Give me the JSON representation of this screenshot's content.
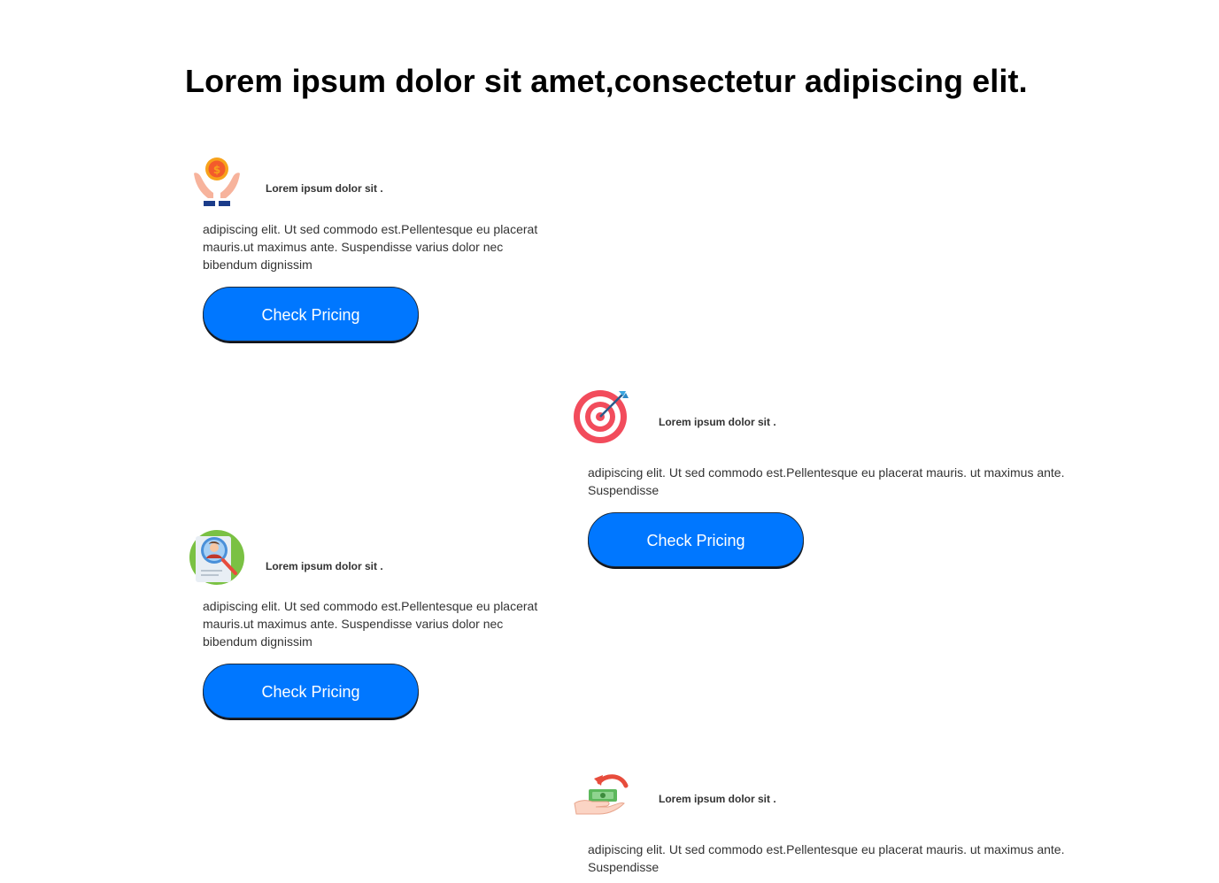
{
  "page": {
    "title": "Lorem ipsum dolor sit amet,consectetur adipiscing elit."
  },
  "features": [
    {
      "icon": "money-hands-icon",
      "heading": "Lorem ipsum dolor sit .",
      "description": "adipiscing elit. Ut sed commodo est.Pellentesque eu placerat mauris.ut maximus ante. Suspendisse varius dolor nec bibendum dignissim",
      "button_label": "Check Pricing"
    },
    {
      "icon": "target-arrow-icon",
      "heading": "Lorem ipsum dolor sit .",
      "description": "adipiscing elit. Ut sed commodo est.Pellentesque eu placerat mauris. ut maximus ante. Suspendisse",
      "button_label": "Check Pricing"
    },
    {
      "icon": "profile-search-icon",
      "heading": "Lorem ipsum dolor sit .",
      "description": "adipiscing elit. Ut sed commodo est.Pellentesque eu placerat mauris.ut maximus ante. Suspendisse varius dolor nec bibendum dignissim",
      "button_label": "Check Pricing"
    },
    {
      "icon": "cashback-hand-icon",
      "heading": "Lorem ipsum dolor sit .",
      "description": "adipiscing elit. Ut sed commodo est.Pellentesque eu placerat mauris. ut maximus ante. Suspendisse"
    }
  ],
  "colors": {
    "button": "#0077ff",
    "title": "#000000",
    "text": "#333333"
  }
}
